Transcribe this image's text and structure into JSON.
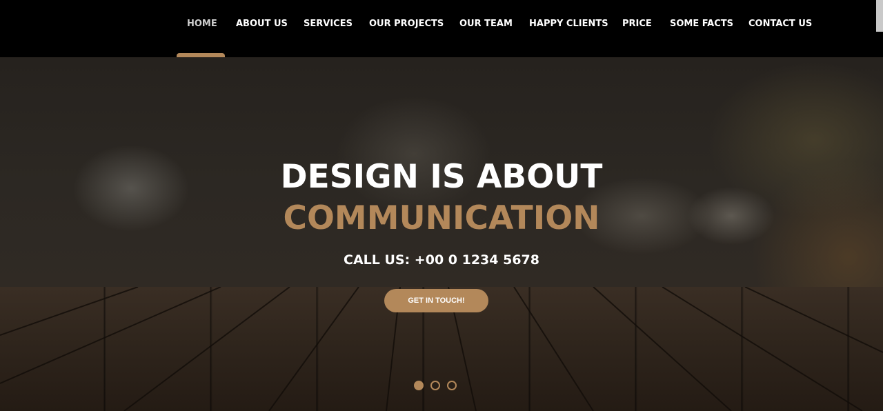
{
  "nav": {
    "items": [
      {
        "label": "HOME",
        "active": true
      },
      {
        "label": "ABOUT US"
      },
      {
        "label": "SERVICES"
      },
      {
        "label": "OUR PROJECTS"
      },
      {
        "label": "OUR TEAM"
      },
      {
        "label": "HAPPY CLIENTS"
      },
      {
        "label": "PRICE"
      },
      {
        "label": "SOME FACTS"
      },
      {
        "label": "CONTACT US"
      }
    ]
  },
  "hero": {
    "title_line1": "DESIGN IS ABOUT",
    "title_line2": "COMMUNICATION",
    "call_us": "CALL US: +00 0 1234 5678",
    "cta_label": "GET IN TOUCH!",
    "slider": {
      "total": 3,
      "active_index": 0
    }
  },
  "colors": {
    "accent": "#b3885a",
    "nav_bg": "#000000",
    "text": "#ffffff"
  }
}
